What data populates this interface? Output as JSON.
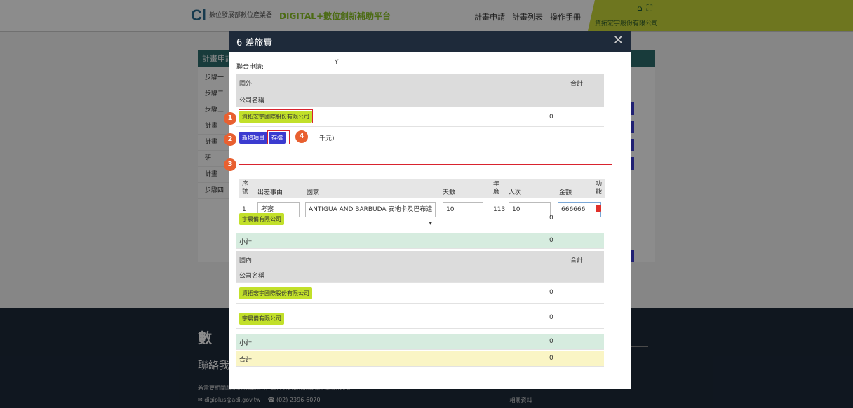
{
  "header": {
    "logo_mark": "Cl",
    "logo_text": "數位發展部數位產業署",
    "brand": "DIGITAL+數位創新補助平台",
    "nav": [
      "計畫申請",
      "計畫列表",
      "操作手冊"
    ],
    "user": "資拓宏宇股份有限公司"
  },
  "background": {
    "panel_title": "計畫申請",
    "steps": [
      "步驟一",
      "步驟二",
      "步驟三",
      "計畫",
      "計畫",
      "研",
      "計畫",
      "步驟四"
    ]
  },
  "footer": {
    "logo": "數",
    "contact_title": "聯絡我",
    "note": "若需要相關服務的詳細說明，歡迎透過Email或電話聯絡我們。",
    "email": "digiplus@adi.gov.tw",
    "phone": "(02) 2396-6070",
    "extra": "相關資料"
  },
  "modal": {
    "title": "6 差旅費",
    "close": "✕",
    "joint_label": "聯合申請:",
    "joint_value": "Y",
    "overseas": {
      "section_label": "國外",
      "total_label": "合計",
      "company_header": "公司名稱",
      "company1": "資拓宏宇國際股份有限公司",
      "company1_total": "0",
      "add_button": "新增項目",
      "save_button": "存檔",
      "unit_note": "千元)",
      "columns": [
        "序號",
        "出差事由",
        "國家",
        "天數",
        "年度",
        "人次",
        "金額",
        "功能"
      ],
      "row": {
        "no": "1",
        "reason": "考察",
        "country": "ANTIGUA AND BARBUDA 安地卡及巴布達",
        "days": "10",
        "year": "113",
        "people": "10",
        "amount": "666666"
      },
      "company2": "宇晨備有限公司",
      "company2_total": "0",
      "subtotal_label": "小計",
      "subtotal_value": "0"
    },
    "domestic": {
      "section_label": "國內",
      "total_label": "合計",
      "company_header": "公司名稱",
      "company1": "資拓宏宇國際股份有限公司",
      "company1_total": "0",
      "company2": "宇晨備有限公司",
      "company2_total": "0",
      "subtotal_label": "小計",
      "subtotal_value": "0",
      "grand_label": "合計",
      "grand_value": "0"
    },
    "markers": [
      "1",
      "2",
      "3",
      "4"
    ]
  }
}
